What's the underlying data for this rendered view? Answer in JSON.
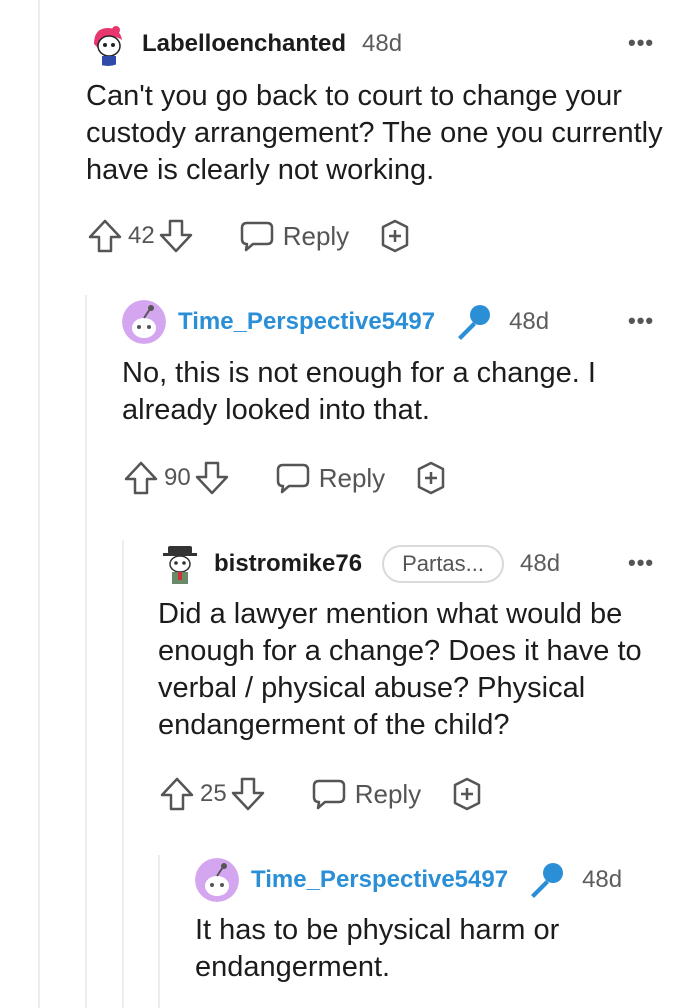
{
  "comments": [
    {
      "username": "Labelloenchanted",
      "age": "48d",
      "body": "Can't you go back to court to change your custody arrangement? The one you currently have is clearly not working.",
      "votes": "42",
      "reply_label": "Reply",
      "more": "•••",
      "is_op": false
    },
    {
      "username": "Time_Perspective5497",
      "age": "48d",
      "body": "No, this is not enough for a change. I already looked into that.",
      "votes": "90",
      "reply_label": "Reply",
      "more": "•••",
      "is_op": true
    },
    {
      "username": "bistromike76",
      "flair": "Partas...",
      "age": "48d",
      "body": "Did a lawyer mention what would be enough for a change? Does it have to verbal / physical abuse? Physical endangerment of the child?",
      "votes": "25",
      "reply_label": "Reply",
      "more": "•••",
      "is_op": false
    },
    {
      "username": "Time_Perspective5497",
      "age": "48d",
      "body": "It has to be physical harm or endangerment.",
      "is_op": true
    }
  ],
  "colors": {
    "op_username": "#2a8fd6",
    "thread_line": "#ededed",
    "mic": "#2a8fd6"
  }
}
